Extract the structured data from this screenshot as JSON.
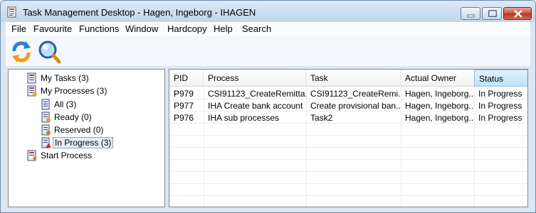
{
  "window": {
    "title": "Task Management Desktop - Hagen, Ingeborg - IHAGEN"
  },
  "menu": [
    "File",
    "Favourite",
    "Functions",
    "Window",
    "Hardcopy",
    "Help",
    "Search"
  ],
  "toolbar": {
    "buttons": [
      {
        "name": "refresh",
        "icon": "refresh-icon"
      },
      {
        "name": "search",
        "icon": "magnifier-icon"
      }
    ]
  },
  "tree": [
    {
      "label": "My Tasks (3)",
      "icon": "tasks-icon",
      "level": 0
    },
    {
      "label": "My Processes (3)",
      "icon": "processes-icon",
      "level": 0
    },
    {
      "label": "All (3)",
      "icon": "list-icon",
      "level": 1
    },
    {
      "label": "Ready (0)",
      "icon": "list-ready-icon",
      "level": 1
    },
    {
      "label": "Reserved (0)",
      "icon": "list-reserved-icon",
      "level": 1
    },
    {
      "label": "In Progress (3)",
      "icon": "list-inprogress-icon",
      "level": 1,
      "selected": true
    },
    {
      "label": "Start Process",
      "icon": "start-process-icon",
      "level": 0
    }
  ],
  "table": {
    "columns": [
      "PID",
      "Process",
      "Task",
      "Actual Owner",
      "Status"
    ],
    "sorted_column": "Status",
    "rows": [
      [
        "P979",
        "CSI91123_CreateRemitta...",
        "CSI91123_CreateRemi...",
        "Hagen, Ingeborg...",
        "In Progress"
      ],
      [
        "P977",
        "IHA Create bank account",
        "Create provisional ban...",
        "Hagen, Ingeborg...",
        "In Progress"
      ],
      [
        "P976",
        "IHA sub processes",
        "Task2",
        "Hagen, Ingeborg...",
        "In Progress"
      ]
    ]
  }
}
